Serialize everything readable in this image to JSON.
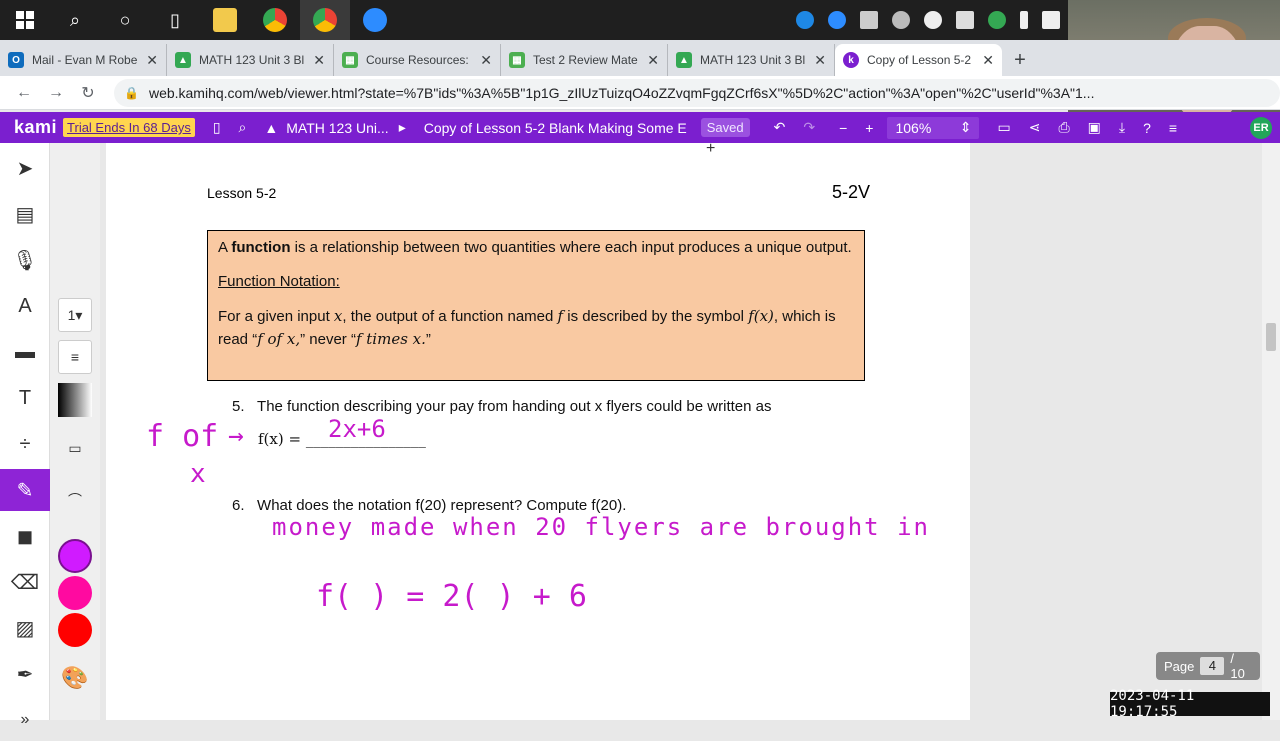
{
  "taskbar": {
    "apps": [
      "windows-start",
      "search",
      "cortana",
      "task-view",
      "file-explorer",
      "chrome",
      "chrome-profile",
      "zoom"
    ]
  },
  "tabs": [
    {
      "title": "Mail - Evan M Robe",
      "icon": "outlook-icon",
      "color": "#0f6cbd"
    },
    {
      "title": "MATH 123 Unit 3 Bl",
      "icon": "drive-icon",
      "color": "#34a853"
    },
    {
      "title": "Course Resources: ",
      "icon": "sheets-icon",
      "color": "#4caf50"
    },
    {
      "title": "Test 2 Review Mate",
      "icon": "sheets-icon",
      "color": "#4caf50"
    },
    {
      "title": "MATH 123 Unit 3 Bl",
      "icon": "drive-icon",
      "color": "#34a853"
    },
    {
      "title": "Copy of Lesson 5-2",
      "icon": "kami-icon",
      "color": "#7b1fcf"
    }
  ],
  "address": {
    "url": "web.kamihq.com/web/viewer.html?state=%7B\"ids\"%3A%5B\"1p1G_zIlUzTuizqO4oZZvqmFgqZCrf6sX\"%5D%2C\"action\"%3A\"open\"%2C\"userId\"%3A\"1..."
  },
  "kami": {
    "logo": "kami",
    "trial": "Trial Ends In 68 Days",
    "path": "MATH 123 Uni...",
    "doc_title": "Copy of Lesson 5-2 Blank Making Some E",
    "saved": "Saved",
    "zoom": "106%",
    "avatar": "ER",
    "accent": "#7b1fcf"
  },
  "palette": {
    "stroke_size": "1",
    "swatches": [
      "#d01bff",
      "#ff0aa0",
      "#ff0000"
    ]
  },
  "document": {
    "lesson": "Lesson 5-2",
    "code": "5-2V",
    "def_intro_a": "A ",
    "def_term": "function",
    "def_intro_b": " is a relationship between two quantities where each input produces a unique output.",
    "notation_heading": "Function Notation:",
    "notation_body_a": "For a given input ",
    "notation_body_x": "x",
    "notation_body_b": ", the output of a function named ",
    "notation_body_f": "f",
    "notation_body_c": " is described by the symbol ",
    "notation_body_fx": "f(x)",
    "notation_body_d": ", which is read “",
    "notation_body_e": "f of x,",
    "notation_body_g": "” never “",
    "notation_body_h": "f times x.",
    "notation_body_i": "”",
    "q5_num": "5.",
    "q5_text": "The function describing your pay from handing out x flyers could be written as",
    "q5_expr": "f(x) = ________________",
    "q6_num": "6.",
    "q6_text": "What does the notation f(20) represent?  Compute f(20).",
    "hw_fof": "f of",
    "hw_arrow": "→",
    "hw_x": "x",
    "hw_answer5": "2x+6",
    "hw_answer6": "money made when 20 flyers are brought in",
    "hw_eq": "f(  ) = 2(  ) + 6"
  },
  "pager": {
    "label": "Page",
    "current": "4",
    "total": "/ 10"
  },
  "timestamp": "2023-04-11  19:17:55"
}
